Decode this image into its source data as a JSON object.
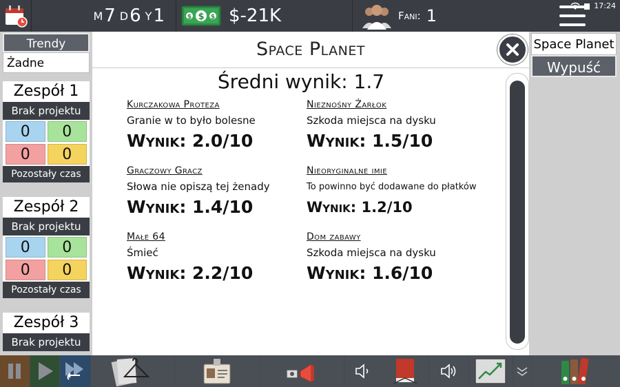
{
  "topbar": {
    "month_label": "M",
    "month_value": "7",
    "week_label": "D",
    "week_value": "6",
    "year_label": "Y",
    "year_value": "1",
    "money": "$-21K",
    "fans_label": "Fani:",
    "fans_value": "1",
    "clock": "17:24"
  },
  "sidebar": {
    "trends_title": "Trendy",
    "trends_value": "Żadne",
    "teams": [
      {
        "name": "Zespół 1",
        "status": "Brak projektu",
        "stats": [
          "0",
          "0",
          "0",
          "0"
        ],
        "time_label": "Pozostały czas"
      },
      {
        "name": "Zespół 2",
        "status": "Brak projektu",
        "stats": [
          "0",
          "0",
          "0",
          "0"
        ],
        "time_label": "Pozostały czas"
      },
      {
        "name": "Zespół 3",
        "status": "Brak projektu"
      }
    ]
  },
  "right_panel": {
    "game_name": "Space Planet",
    "release_label": "Wypuść"
  },
  "dialog": {
    "title": "Space Planet",
    "average": "Średni wynik: 1.7",
    "reviews": [
      {
        "reviewer": "Kurczakowa Proteza",
        "comment": "Granie w to było bolesne",
        "score": "Wynik: 2.0/10"
      },
      {
        "reviewer": "Nieznośny Żarłok",
        "comment": "Szkoda miejsca na dysku",
        "score": "Wynik: 1.5/10"
      },
      {
        "reviewer": "Graczowy Gracz",
        "comment": "Słowa nie opiszą tej żenady",
        "score": "Wynik: 1.4/10"
      },
      {
        "reviewer": "Nieoryginalne imie",
        "comment": "To powinno być dodawane do płatków",
        "score": "Wynik: 1.2/10"
      },
      {
        "reviewer": "Małe 64",
        "comment": "Śmieć",
        "score": "Wynik: 2.2/10"
      },
      {
        "reviewer": "Dom zabawy",
        "comment": "Szkoda miejsca na dysku",
        "score": "Wynik: 1.6/10"
      }
    ]
  },
  "colors": {
    "bar_dark": "#3a3e44",
    "stat_blue": "#a8d4f0",
    "stat_green": "#a8e39b",
    "stat_red": "#f2a0a0",
    "stat_yellow": "#f4d35e",
    "money_green": "#3aa655"
  },
  "icons": {
    "calendar": "calendar-icon",
    "money": "money-icon",
    "fans": "fans-icon",
    "menu": "menu-icon",
    "close": "close-icon",
    "pause": "pause-icon",
    "play": "play-icon",
    "fast_forward": "fast-forward-icon",
    "hanger": "hanger-icon",
    "id_card": "id-card-icon",
    "megaphone": "megaphone-icon",
    "volume_down": "volume-down-icon",
    "volume_up": "volume-up-icon",
    "book": "book-icon",
    "chart": "chart-icon",
    "chevron_down": "chevron-down-icon",
    "folders": "folders-icon"
  }
}
